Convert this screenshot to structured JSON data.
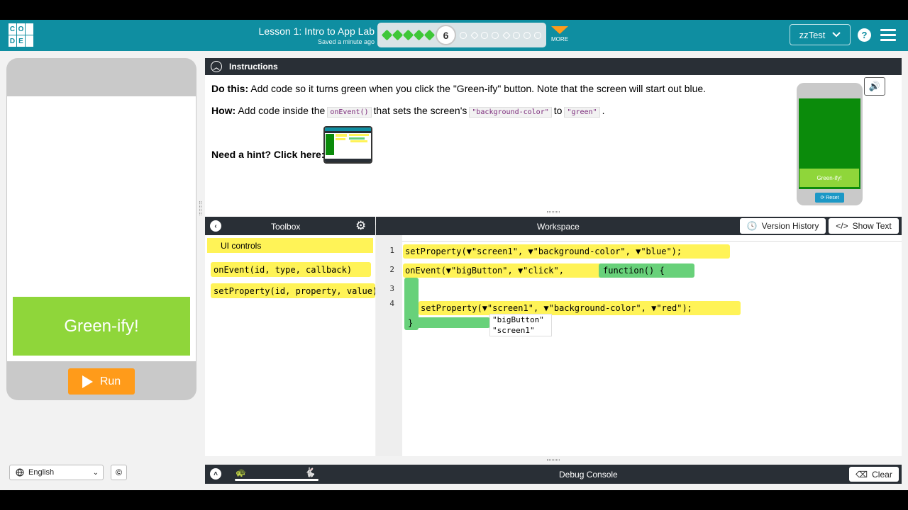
{
  "header": {
    "logo_letters": [
      "C",
      "O",
      "D",
      "E"
    ],
    "lesson_title": "Lesson 1: Intro to App Lab",
    "saved_status": "Saved a minute ago",
    "current_level": "6",
    "more_label": "MORE",
    "user_name": "zzTest",
    "help_label": "?"
  },
  "preview": {
    "greenify_label": "Green-ify!",
    "run_label": "Run",
    "language": "English",
    "copyright_symbol": "©"
  },
  "instructions": {
    "header": "Instructions",
    "do_this_label": "Do this:",
    "do_this_text": " Add code so it turns green when you click the \"Green-ify\" button. Note that the screen will start out blue.",
    "how_label": "How:",
    "how_text_1": " Add code inside the",
    "how_code_1": "onEvent()",
    "how_text_2": "that sets the screen's",
    "how_code_2": "\"background-color\"",
    "how_text_3": "to",
    "how_code_3": "\"green\"",
    "how_text_4": ".",
    "hint_label": "Need a hint? Click here:",
    "mini_btn_label": "Green-ify!",
    "mini_reset_label": "Reset"
  },
  "toolbox": {
    "title": "Toolbox",
    "category": "UI controls",
    "blocks": [
      "onEvent(id, type, callback)",
      "setProperty(id, property, value)"
    ]
  },
  "workspace": {
    "title": "Workspace",
    "version_history": "Version History",
    "show_text": "Show Text",
    "line_numbers": [
      "1",
      "2",
      "3",
      "4"
    ],
    "line1": "setProperty(▼\"screen1\", ▼\"background-color\", ▼\"blue\");",
    "line2": "onEvent(▼\"bigButton\", ▼\"click\", ",
    "line2_fn": "function() {",
    "line3": "setProperty(▼\"screen1\", ▼\"background-color\", ▼\"red\");",
    "line4": "}",
    "autocomplete": [
      "\"bigButton\"",
      "\"screen1\""
    ]
  },
  "debug": {
    "title": "Debug Console",
    "clear_label": "Clear"
  },
  "colors": {
    "header_teal": "#0f8ea1",
    "dark_bar": "#292f36",
    "block_yellow": "#fff357",
    "fn_green": "#68d17a",
    "run_orange": "#ff9b1a",
    "button_green": "#8fd63a"
  }
}
